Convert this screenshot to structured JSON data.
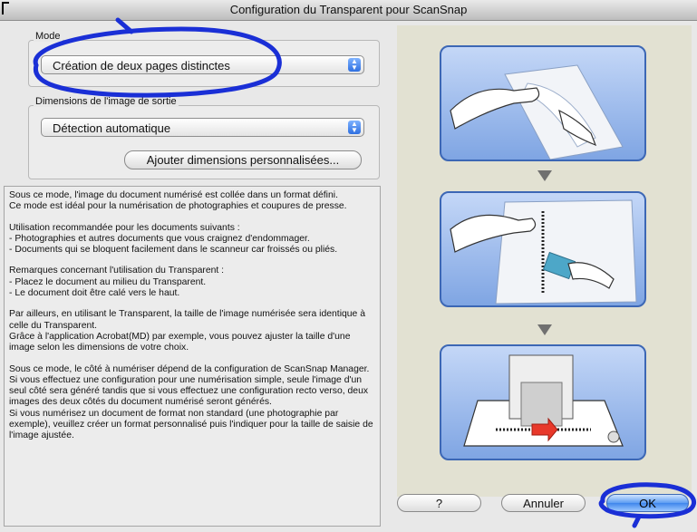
{
  "window": {
    "title": "Configuration du Transparent pour ScanSnap"
  },
  "mode_group": {
    "label": "Mode",
    "selected": "Création de deux pages distinctes"
  },
  "output_group": {
    "label": "Dimensions de l'image de sortie",
    "selected": "Détection automatique",
    "add_custom_label": "Ajouter dimensions personnalisées..."
  },
  "description": {
    "paragraphs": [
      "Sous ce mode, l'image du document numérisé est collée dans un format défini.\nCe mode est idéal pour la numérisation de photographies et coupures de presse.",
      "Utilisation recommandée pour les documents suivants :\n- Photographies et autres documents que vous craignez d'endommager.\n- Documents qui se bloquent facilement dans le scanneur car froissés ou pliés.",
      "Remarques concernant l'utilisation du Transparent :\n- Placez le document au milieu du Transparent.\n- Le document doit être calé vers le haut.",
      "Par ailleurs, en utilisant le Transparent, la taille de l'image numérisée sera identique à celle du Transparent.\nGrâce à l'application Acrobat(MD) par exemple, vous pouvez ajuster la taille d'une image selon les dimensions de votre choix.",
      "Sous ce mode, le côté à numériser dépend de la configuration de ScanSnap Manager. Si vous effectuez une configuration pour une numérisation simple, seule l'image d'un seul côté sera généré tandis que si vous effectuez une configuration recto verso, deux images des deux côtés du document numérisé seront générés.\nSi vous numérisez un document de format non standard (une photographie par exemple), veuillez créer un format personnalisé puis l'indiquer pour la taille de saisie de l'image ajustée."
    ]
  },
  "buttons": {
    "help_label": "?",
    "cancel_label": "Annuler",
    "ok_label": "OK"
  },
  "colors": {
    "annotation": "#1a2fd6",
    "illustration_frame": "#3c67b5"
  }
}
